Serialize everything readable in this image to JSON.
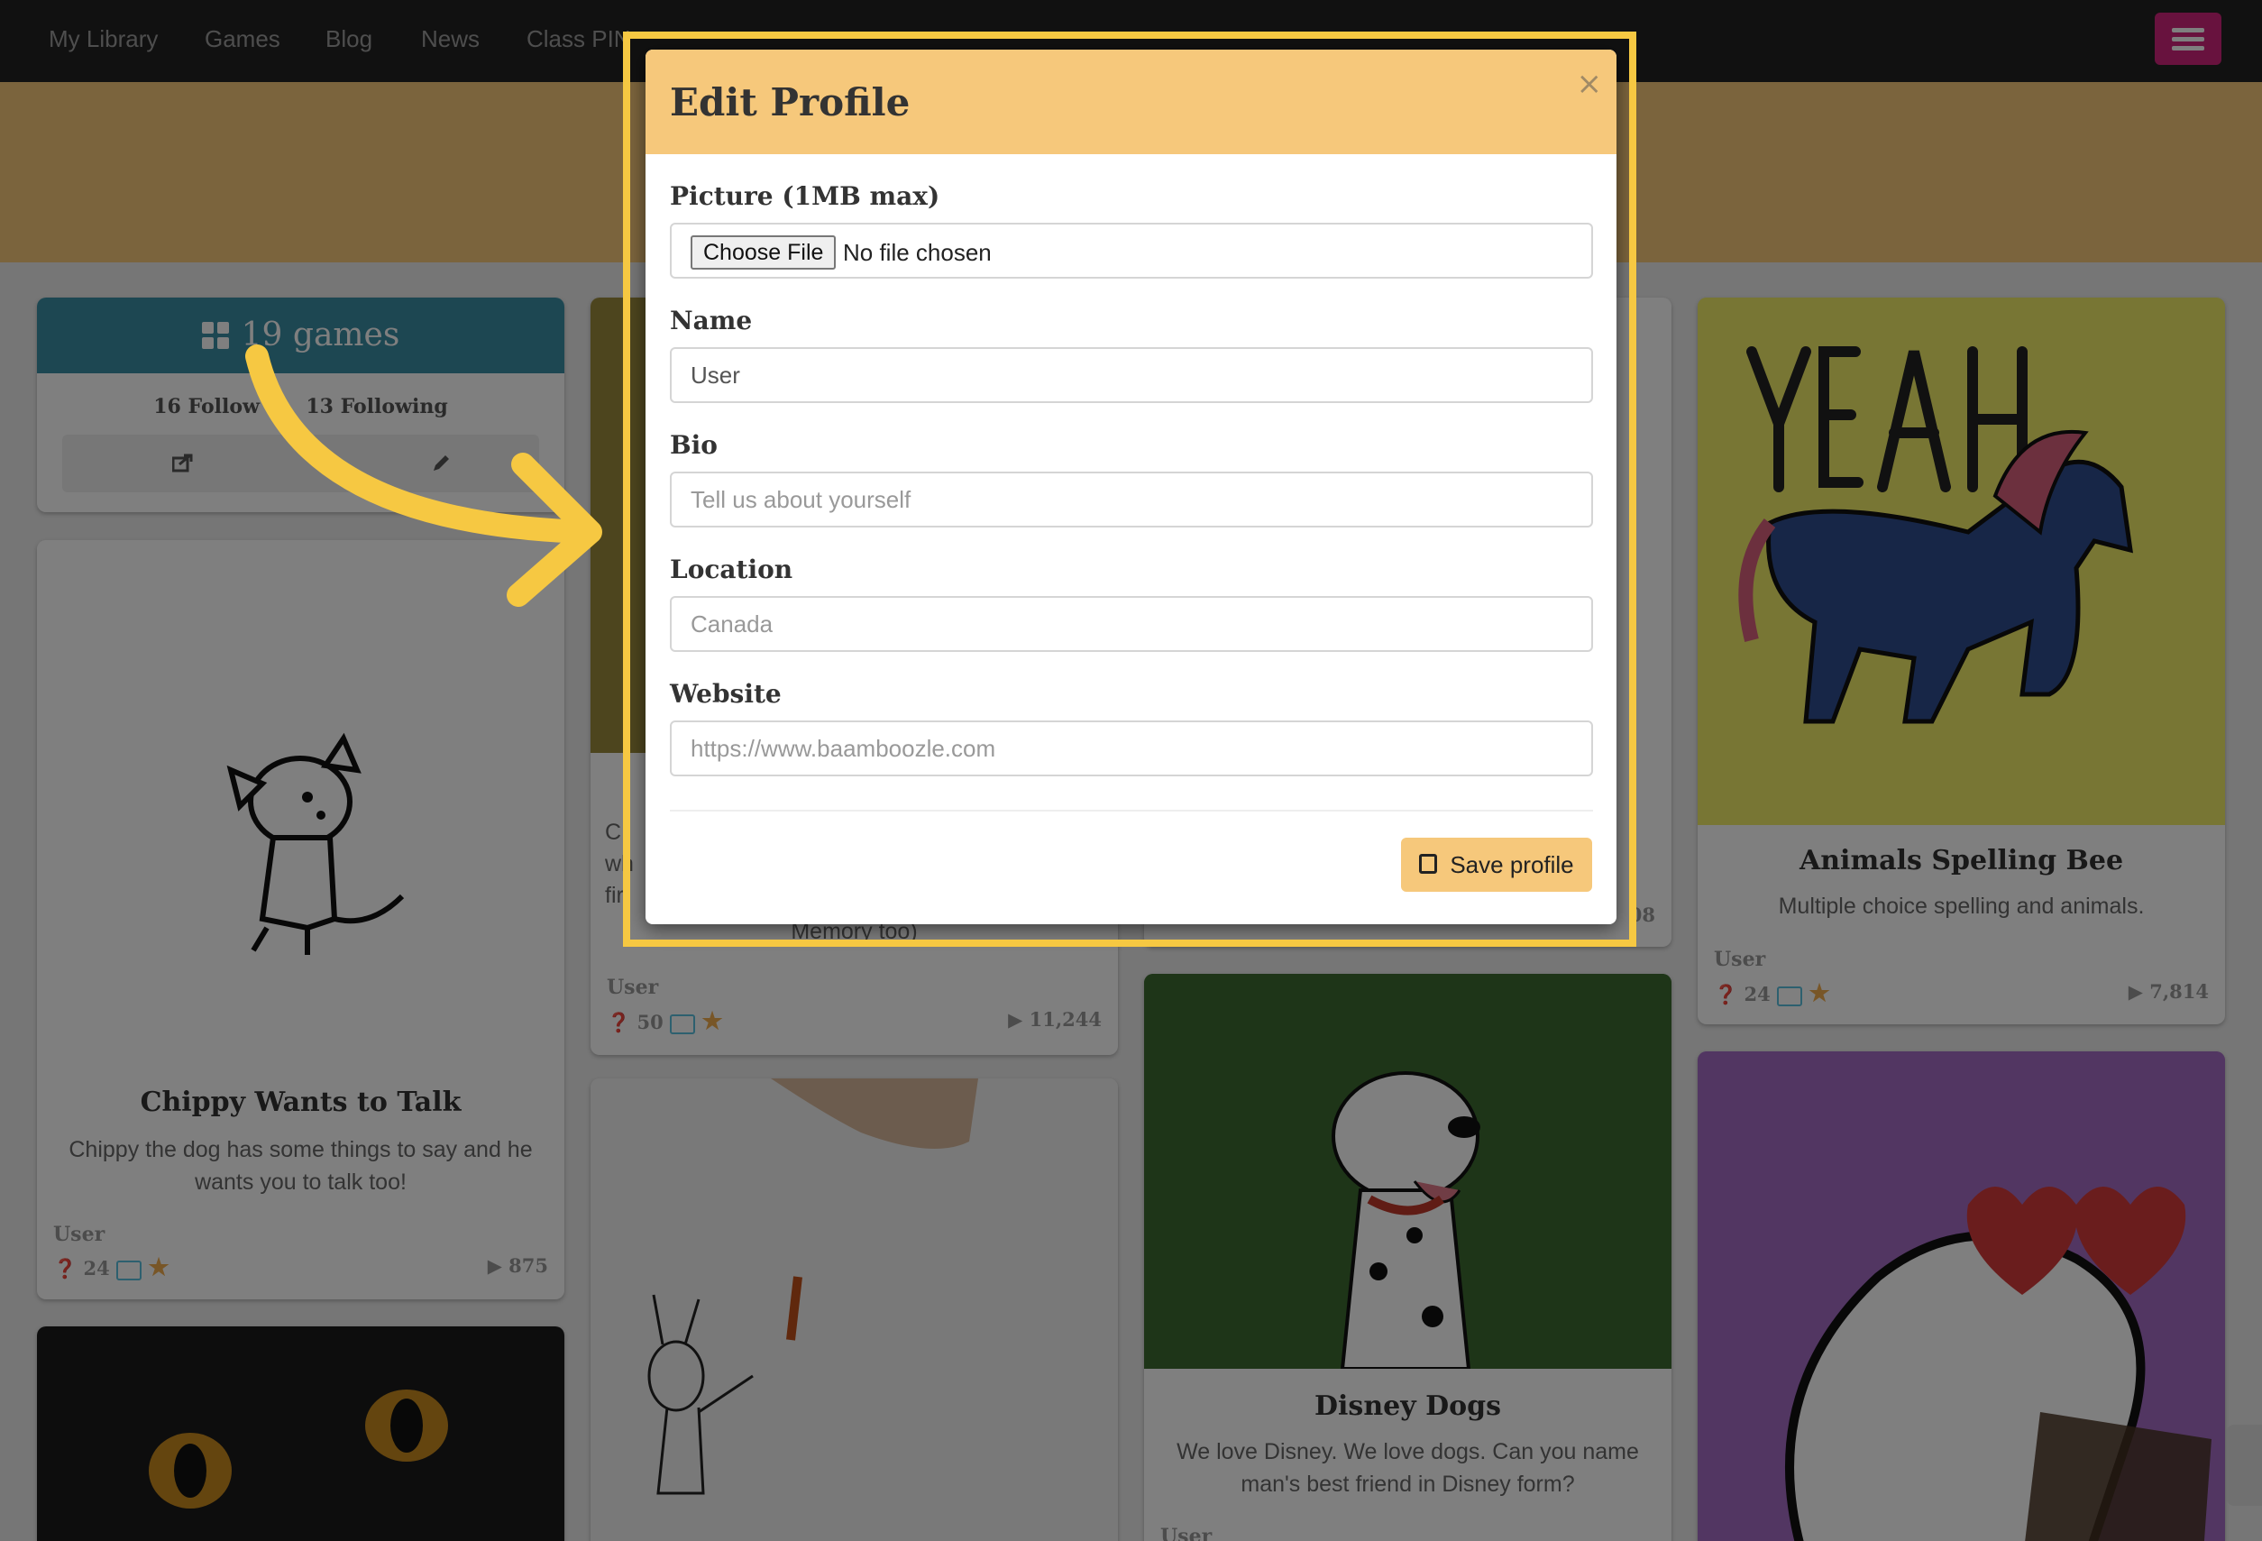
{
  "navbar": {
    "links": [
      "My Library",
      "Games",
      "Blog",
      "News",
      "Class PIN"
    ],
    "menu_icon": "hamburger-menu-icon"
  },
  "profile_card": {
    "games_label": "19 games",
    "followers_label": "16 Follow",
    "following_label": "13 Following",
    "share_icon": "share-icon",
    "edit_icon": "pencil-icon"
  },
  "cards": [
    {
      "title": "Chippy Wants to Talk",
      "description": "Chippy the dog has some things to say and he wants you to talk too!",
      "user": "User",
      "questions": "24",
      "plays": "875"
    },
    {
      "title": "",
      "description_fragments": [
        "C",
        "wh",
        "fir",
        "Memory too)"
      ],
      "user": "User",
      "questions": "50",
      "plays": "11,244"
    },
    {
      "title": "",
      "user": "",
      "plays_fragment": "08"
    },
    {
      "title": "Animals Spelling Bee",
      "description": "Multiple choice spelling and animals.",
      "user": "User",
      "questions": "24",
      "plays": "7,814"
    },
    {
      "title": "Disney Dogs",
      "description": "We love Disney. We love dogs. Can you name man's best friend in Disney form?",
      "user": "User"
    }
  ],
  "modal": {
    "title": "Edit Profile",
    "close_label": "×",
    "picture_label": "Picture (1MB max)",
    "choose_file_label": "Choose File",
    "no_file_label": "No file chosen",
    "name_label": "Name",
    "name_value": "User",
    "bio_label": "Bio",
    "bio_placeholder": "Tell us about yourself",
    "location_label": "Location",
    "location_placeholder": "Canada",
    "website_label": "Website",
    "website_placeholder": "https://www.baamboozle.com",
    "save_label": "Save profile",
    "save_icon": "floppy-disk-icon"
  },
  "colors": {
    "navbar": "#222222",
    "banner": "#f6c87b",
    "modal_header": "#f6c87b",
    "highlight": "#f6c842",
    "profile_header": "#3a8ea5",
    "menu_button": "#d1257c",
    "save_button": "#f6c87b"
  }
}
